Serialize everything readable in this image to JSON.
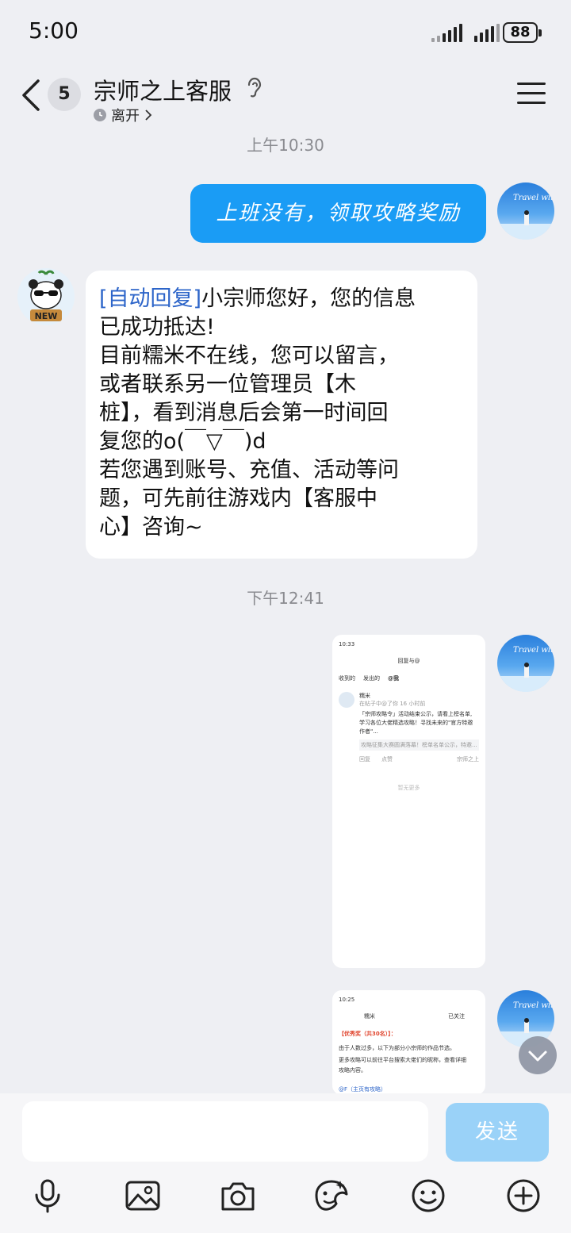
{
  "status_bar": {
    "time": "5:00",
    "battery": "88"
  },
  "header": {
    "unread_count": "5",
    "title": "宗师之上客服",
    "presence": "离开",
    "help_icon": "ear-question-icon",
    "menu_icon": "hamburger-menu-icon"
  },
  "chat": {
    "time1": "上午10:30",
    "outgoing_text": "上班没有，领取攻略奖励",
    "auto_reply_tag": "[自动回复]",
    "auto_reply_lines": [
      "小宗师您好，您的信息",
      "已成功抵达!",
      "目前糯米不在线，您可以留言，",
      "或者联系另一位管理员【木",
      "桩】，看到消息后会第一时间回",
      "复您的o(￣▽￣)d",
      "若您遇到账号、充值、活动等问",
      "题，可先前往游戏内【客服中",
      "心】咨询~"
    ],
    "time2": "下午12:41",
    "panda_avatar_label": "NEW",
    "my_avatar_text": "Travel with you",
    "shot1": {
      "time": "10:33",
      "title": "回复与@",
      "tabs": [
        "收到的",
        "发出的",
        "@我"
      ],
      "user": "糯米",
      "meta": "在帖子中@了你 16 小时前",
      "body1": "「宗师攻略令」活动结束公示，请看上榜名单,",
      "body2": "学习各位大佬精选攻略！寻找未来的\"官方特邀",
      "body3": "作者\"...",
      "quote": "攻略征集大赛圆满落幕！榜单名单公示，特邀...",
      "reply": "回复",
      "like": "点赞",
      "source": "宗师之上",
      "empty": "暂无更多"
    },
    "shot2": {
      "time": "10:25",
      "user": "糯米",
      "follow": "已关注",
      "heading": "【优秀奖（共30名）】：",
      "line1": "由于人数过多，以下为部分小宗师的作品节选。",
      "line2": "更多攻略可以前往平台搜索大佬们的昵称，查看详细",
      "line3": "攻略内容。",
      "link": "@F（主页有攻略）"
    }
  },
  "input": {
    "placeholder": "",
    "send_label": "发送"
  },
  "toolbar": [
    "microphone-icon",
    "image-icon",
    "camera-icon",
    "sticker-icon",
    "emoji-icon",
    "plus-icon"
  ],
  "colors": {
    "accent": "#1a9cf5",
    "send_disabled": "#9ad2f8",
    "background": "#eeeff3"
  }
}
